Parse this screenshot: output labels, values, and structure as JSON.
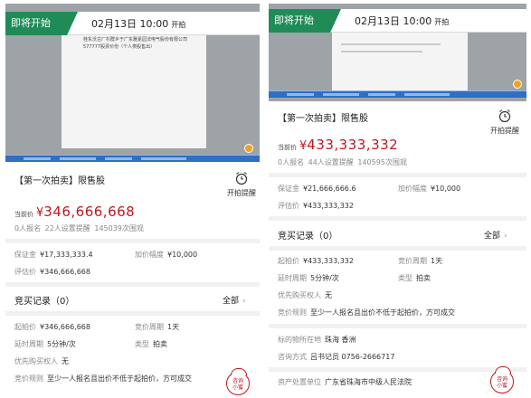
{
  "left": {
    "badge": "即将开始",
    "start_time": "02月13日 10:00",
    "start_suffix": "开拍",
    "doc_text": "桂东沃古厂杉群乡于广东雅素园法电气股份有限公司 577777股票价份（个人类股售出）",
    "title": "【第一次拍卖】限售股",
    "alarm_label": "开拍提醒",
    "price_label": "当前价",
    "price_symbol": "¥",
    "price_value": "346,666,668",
    "stats": "0人报名  22人设置提醒  145039次围观",
    "deposit_label": "保证金",
    "deposit_value": "¥17,333,333.4",
    "increment_label": "加价幅度",
    "increment_value": "¥10,000",
    "appraisal_label": "评估价",
    "appraisal_value": "¥346,666,668",
    "records_label": "竞买记录（0）",
    "all_label": "全部",
    "start_price_label": "起拍价",
    "start_price_value": "¥346,666,668",
    "cycle_label": "竞价周期",
    "cycle_value": "1天",
    "delay_label": "延时周期",
    "delay_value": "5分钟/次",
    "type_label": "类型",
    "type_value": "拍卖",
    "priority_label": "优先购买权人",
    "priority_value": "无",
    "rules_label": "竞价规则",
    "rules_value": "至少一人报名且出价不低于起拍价，方可成交",
    "consult": "咨询\n小蜜"
  },
  "right": {
    "badge": "即将开始",
    "start_time": "02月13日 10:00",
    "start_suffix": "开拍",
    "title": "【第一次拍卖】限售股",
    "alarm_label": "开拍提醒",
    "price_label": "当前价",
    "price_symbol": "¥",
    "price_value": "433,333,332",
    "stats": "0人报名  44人设置提醒  140595次围观",
    "deposit_label": "保证金",
    "deposit_value": "¥21,666,666.6",
    "increment_label": "加价幅度",
    "increment_value": "¥10,000",
    "appraisal_label": "评估价",
    "appraisal_value": "¥433,333,332",
    "records_label": "竞买记录（0）",
    "all_label": "全部",
    "start_price_label": "起拍价",
    "start_price_value": "¥433,333,332",
    "cycle_label": "竞价周期",
    "cycle_value": "1天",
    "delay_label": "延时周期",
    "delay_value": "5分钟/次",
    "type_label": "类型",
    "type_value": "拍卖",
    "priority_label": "优先购买权人",
    "priority_value": "无",
    "rules_label": "竞价规则",
    "rules_value": "至少一人报名且出价不低于起拍价，方可成交",
    "location_label": "标的物所在地",
    "location_value": "珠海 香洲",
    "contact_label": "咨询方式",
    "contact_value": "吕书记员  0756-2666717",
    "court_label": "资产处置单位",
    "court_value": "广东省珠海市中级人民法院",
    "consult": "咨询\n小蜜"
  },
  "colors": {
    "accent_red": "#c0171e",
    "badge_green": "#1f8c57"
  }
}
